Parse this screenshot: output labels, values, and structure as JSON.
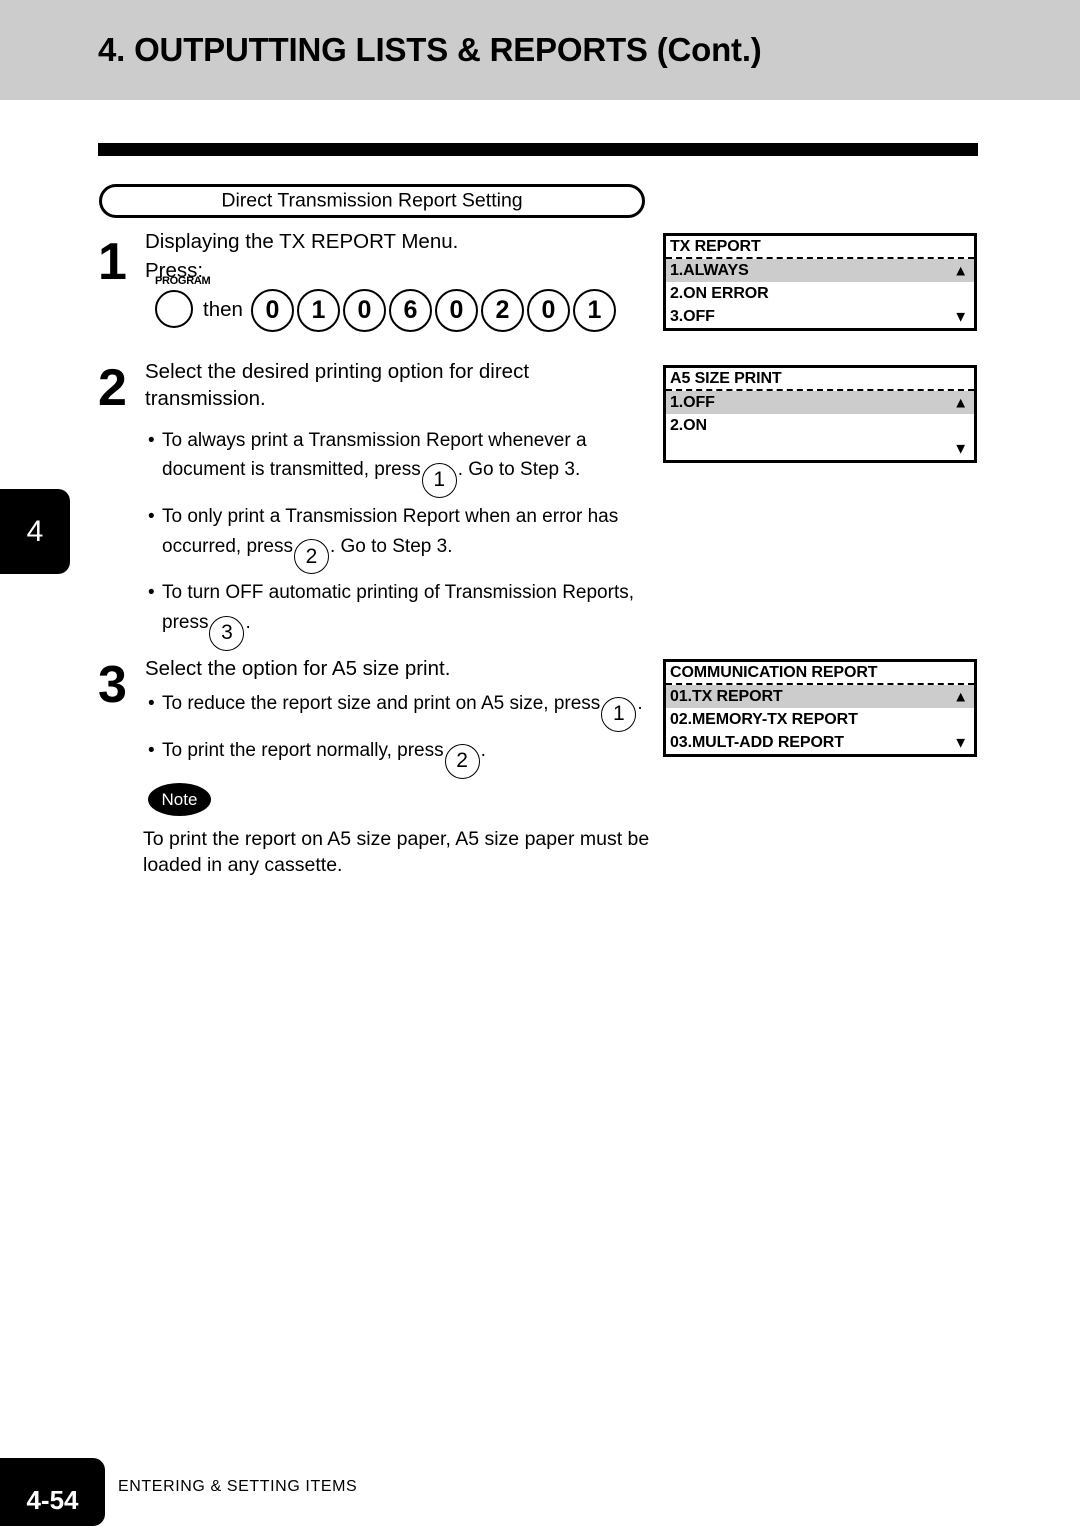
{
  "header": {
    "title": "4. OUTPUTTING LISTS & REPORTS (Cont.)"
  },
  "section": {
    "pill_label": "Direct Transmission Report Setting"
  },
  "side_tab": {
    "chapter": "4"
  },
  "steps": [
    {
      "number": "1",
      "title_line1": "Displaying the TX REPORT Menu.",
      "title_line2": "Press:",
      "program_caption": "PROGRAM",
      "then_label": "then",
      "keys": [
        "0",
        "1",
        "0",
        "6",
        "0",
        "2",
        "0",
        "1"
      ]
    },
    {
      "number": "2",
      "title_line1": "Select the desired printing option for direct",
      "title_line2": "transmission.",
      "bullets": [
        {
          "text_a": "To always print a Transmission Report whenever a document is transmitted, press",
          "key": "1",
          "text_b": ".  Go to Step 3."
        },
        {
          "text_a": "To only print a Transmission Report when an error has occurred, press",
          "key": "2",
          "text_b": ".  Go to Step 3."
        },
        {
          "text_a": "To turn OFF automatic printing of Transmission Reports, press",
          "key": "3",
          "text_b": "."
        }
      ]
    },
    {
      "number": "3",
      "title_line1": "Select the option for A5 size print.",
      "bullets": [
        {
          "text_a": "To reduce the report size and print on A5 size, press",
          "key": "1",
          "text_b": "."
        },
        {
          "text_a": "To print the report normally, press",
          "key": "2",
          "text_b": "."
        }
      ]
    }
  ],
  "note": {
    "badge_label": "Note",
    "line1": "To print the report on A5 size paper, A5 size paper must be",
    "line2": "loaded in any cassette."
  },
  "lcd_panels": [
    {
      "title": "TX REPORT",
      "rows": [
        {
          "label": "1.ALWAYS",
          "highlighted": true,
          "arrow": "▲"
        },
        {
          "label": "2.ON ERROR",
          "highlighted": false,
          "arrow": ""
        },
        {
          "label": "3.OFF",
          "highlighted": false,
          "arrow": "▼"
        }
      ]
    },
    {
      "title": "A5 SIZE PRINT",
      "rows": [
        {
          "label": "1.OFF",
          "highlighted": true,
          "arrow": "▲"
        },
        {
          "label": "2.ON",
          "highlighted": false,
          "arrow": ""
        },
        {
          "label": "",
          "highlighted": false,
          "arrow": "▼"
        }
      ]
    },
    {
      "title": "COMMUNICATION REPORT",
      "rows": [
        {
          "label": "01.TX REPORT",
          "highlighted": true,
          "arrow": "▲"
        },
        {
          "label": "02.MEMORY-TX REPORT",
          "highlighted": false,
          "arrow": ""
        },
        {
          "label": "03.MULT-ADD REPORT",
          "highlighted": false,
          "arrow": "▼"
        }
      ]
    }
  ],
  "footer": {
    "page_number": "4-54",
    "label": "ENTERING & SETTING ITEMS"
  }
}
